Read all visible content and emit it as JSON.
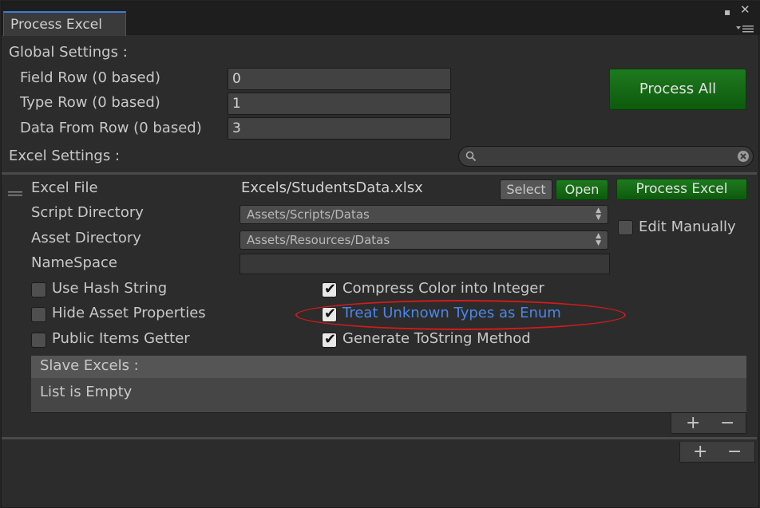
{
  "window": {
    "tab_title": "Process Excel",
    "menu_icon": "kebab-menu-icon"
  },
  "global_settings": {
    "heading": "Global Settings :",
    "fields": [
      {
        "label": "Field Row (0 based)",
        "value": "0"
      },
      {
        "label": "Type Row (0 based)",
        "value": "1"
      },
      {
        "label": "Data From Row (0 based)",
        "value": "3"
      }
    ],
    "process_all_label": "Process All"
  },
  "excel_settings": {
    "heading": "Excel Settings :",
    "search_value": ""
  },
  "excel_item": {
    "file_label": "Excel File",
    "file_value": "Excels/StudentsData.xlsx",
    "select_label": "Select",
    "open_label": "Open",
    "process_label": "Process Excel",
    "script_dir_label": "Script Directory",
    "script_dir_value": "Assets/Scripts/Datas",
    "asset_dir_label": "Asset Directory",
    "asset_dir_value": "Assets/Resources/Datas",
    "edit_manually_label": "Edit Manually",
    "edit_manually_checked": false,
    "namespace_label": "NameSpace",
    "namespace_value": "",
    "options_left": [
      {
        "label": "Use Hash String",
        "checked": false
      },
      {
        "label": "Hide Asset Properties",
        "checked": false
      },
      {
        "label": "Public Items Getter",
        "checked": false
      }
    ],
    "options_right": [
      {
        "label": "Compress Color into Integer",
        "checked": true
      },
      {
        "label": "Treat Unknown Types as Enum",
        "checked": true
      },
      {
        "label": "Generate ToString Method",
        "checked": true
      }
    ],
    "slave_excels_heading": "Slave Excels :",
    "slave_excels_empty": "List is Empty"
  },
  "list_controls": {
    "plus": "+",
    "minus": "−"
  },
  "colors": {
    "highlight_text": "#4a87e8",
    "annotation_ring": "#d21b1b",
    "green_button": "#1e7a1e"
  }
}
